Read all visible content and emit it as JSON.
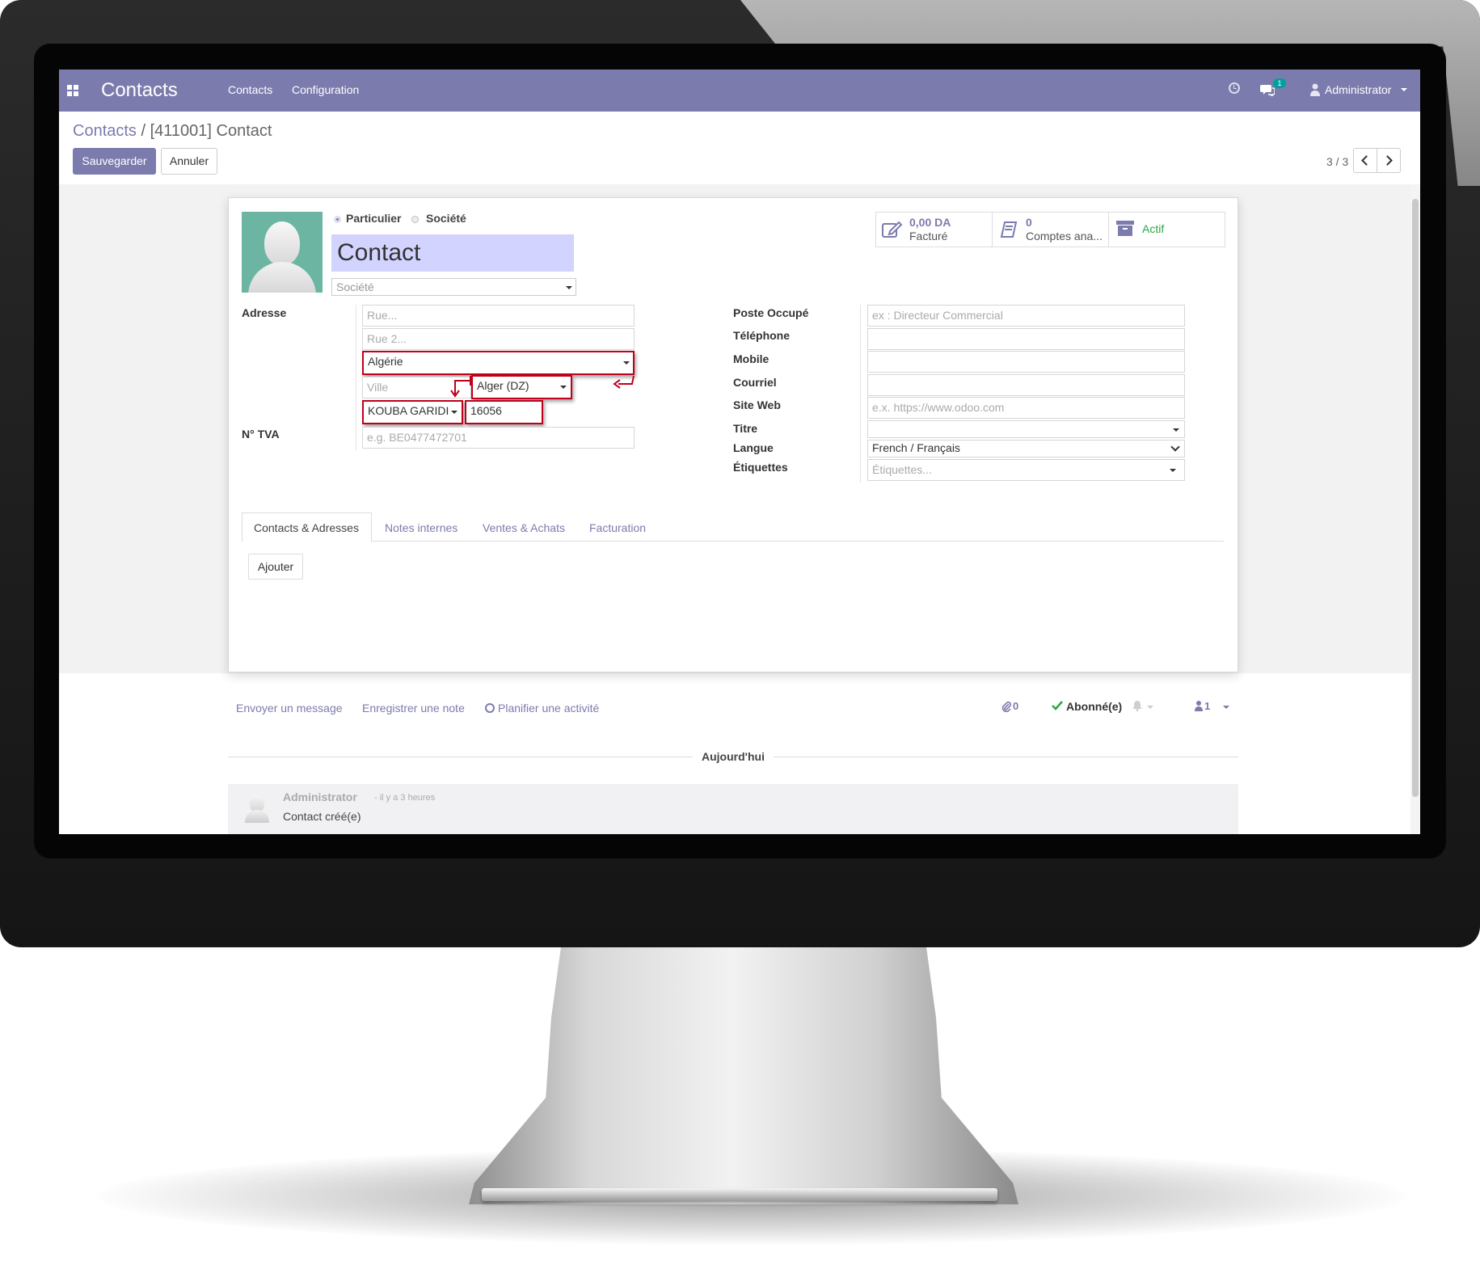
{
  "navbar": {
    "app_title": "Contacts",
    "menu": [
      "Contacts",
      "Configuration"
    ],
    "chat_count": "1",
    "user": "Administrator"
  },
  "control": {
    "breadcrumb_parent": "Contacts",
    "breadcrumb_sep": " / ",
    "breadcrumb_current": "[411001] Contact",
    "save_label": "Sauvegarder",
    "cancel_label": "Annuler",
    "pager": "3 / 3"
  },
  "form": {
    "type_options": [
      "Particulier",
      "Société"
    ],
    "type_selected": "Particulier",
    "name": "Contact",
    "company_placeholder": "Société",
    "stats": [
      {
        "value": "0,00 DA",
        "label": "Facturé",
        "icon": "invoice-edit-icon"
      },
      {
        "value": "0",
        "label": "Comptes ana...",
        "icon": "book-icon"
      },
      {
        "value": "",
        "label": "Actif",
        "icon": "archive-icon"
      }
    ],
    "address_label": "Adresse",
    "street_placeholder": "Rue...",
    "street2_placeholder": "Rue 2...",
    "country": "Algérie",
    "city_placeholder": "Ville",
    "state": "Alger (DZ)",
    "city": "KOUBA GARIDI",
    "zip": "16056",
    "vat_label": "N° TVA",
    "vat_placeholder": "e.g. BE0477472701",
    "function_label": "Poste Occupé",
    "function_placeholder": "ex : Directeur Commercial",
    "phone_label": "Téléphone",
    "mobile_label": "Mobile",
    "email_label": "Courriel",
    "website_label": "Site Web",
    "website_placeholder": "e.x. https://www.odoo.com",
    "title_label": "Titre",
    "lang_label": "Langue",
    "lang_value": "French / Français",
    "tags_label": "Étiquettes",
    "tags_placeholder": "Étiquettes..."
  },
  "tabs": [
    "Contacts & Adresses",
    "Notes internes",
    "Ventes & Achats",
    "Facturation"
  ],
  "active_tab": "Contacts & Adresses",
  "add_label": "Ajouter",
  "chatter": {
    "send_message": "Envoyer un message",
    "log_note": "Enregistrer une note",
    "schedule_activity": "Planifier une activité",
    "attachments": "0",
    "follow_status": "Abonné(e)",
    "followers": "1",
    "today": "Aujourd'hui",
    "message_author": "Administrator",
    "message_time": "- il y a 3 heures",
    "message_body": "Contact créé(e)"
  },
  "colors": {
    "brand": "#7c7bad",
    "highlight_border": "#c0001a",
    "name_field_bg": "#d2d3ff",
    "active_green": "#28a745"
  }
}
